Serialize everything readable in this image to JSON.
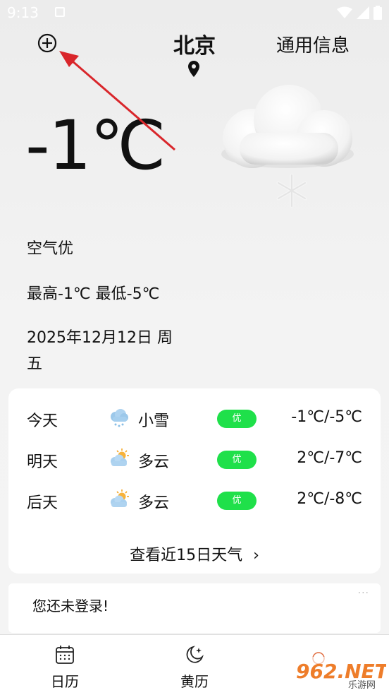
{
  "status_bar": {
    "time": "9:13"
  },
  "header": {
    "city": "北京",
    "general_info": "通用信息"
  },
  "current": {
    "temperature": "-1℃",
    "air_quality": "空气优",
    "high_low": "最高-1℃ 最低-5℃",
    "date_line1": "2025年12月12日 周",
    "date_line2": "五"
  },
  "forecast": {
    "rows": [
      {
        "day": "今天",
        "icon": "light-snow-icon",
        "condition": "小雪",
        "aqi": "优",
        "range": "-1℃/-5℃"
      },
      {
        "day": "明天",
        "icon": "partly-cloudy-icon",
        "condition": "多云",
        "aqi": "优",
        "range": "2℃/-7℃"
      },
      {
        "day": "后天",
        "icon": "partly-cloudy-icon",
        "condition": "多云",
        "aqi": "优",
        "range": "2℃/-8℃"
      }
    ],
    "more_label": "查看近15日天气",
    "more_chevron": "›"
  },
  "login_card": {
    "message": "您还未登录!",
    "dots": "···"
  },
  "bottom_nav": {
    "items": [
      {
        "label": "日历"
      },
      {
        "label": "黄历"
      }
    ]
  },
  "watermark": {
    "text": "962.NET",
    "sub": "乐游网"
  },
  "colors": {
    "aqi_good": "#1fe04a",
    "annotation_arrow": "#d9262b"
  }
}
